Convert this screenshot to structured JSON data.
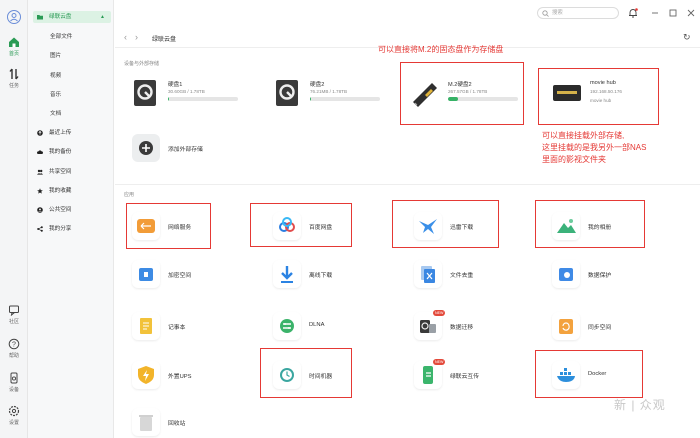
{
  "rail": {
    "items": [
      {
        "label": "首页",
        "icon": "home-icon"
      },
      {
        "label": "任务",
        "icon": "transfer-icon"
      },
      {
        "label": "社区",
        "icon": "chat-icon"
      },
      {
        "label": "帮助",
        "icon": "help-icon"
      },
      {
        "label": "设备",
        "icon": "device-icon"
      },
      {
        "label": "设置",
        "icon": "gear-icon"
      }
    ]
  },
  "sidebar": {
    "top": "绿联云盘",
    "items": [
      "全部文件",
      "图片",
      "视频",
      "音乐",
      "文档"
    ],
    "groups": [
      "最近上传",
      "我的备份",
      "共享空间",
      "我的收藏",
      "公共空间",
      "我的分享"
    ]
  },
  "header": {
    "search_placeholder": "搜索",
    "breadcrumb": "绿联云盘"
  },
  "storage": {
    "section_label": "设备与外部存储",
    "disks": [
      {
        "name": "硬盘1",
        "size": "30.60GB / 1.78TB",
        "percent": 2
      },
      {
        "name": "硬盘2",
        "size": "76.21MB / 1.78TB",
        "percent": 1
      },
      {
        "name": "M.2硬盘2",
        "size": "267.57GB / 1.78TB",
        "percent": 14
      },
      {
        "name": "movie hub",
        "size": "192.168.50.176",
        "sub": "movie hub"
      }
    ],
    "add_label": "添加外部存储"
  },
  "apps": {
    "section_label": "应用",
    "items": [
      {
        "name": "网络服务"
      },
      {
        "name": "百度网盘"
      },
      {
        "name": "迅雷下载"
      },
      {
        "name": "我的相册"
      },
      {
        "name": "加密空间"
      },
      {
        "name": "离线下载"
      },
      {
        "name": "文件去重"
      },
      {
        "name": "数据保护"
      },
      {
        "name": "记事本"
      },
      {
        "name": "DLNA"
      },
      {
        "name": "数据迁移",
        "badge": "NEW"
      },
      {
        "name": "同步空间"
      },
      {
        "name": "外置UPS"
      },
      {
        "name": "时间机器"
      },
      {
        "name": "绿联云互传",
        "badge": "NEW"
      },
      {
        "name": "Docker"
      },
      {
        "name": "回收站"
      }
    ]
  },
  "annotations": {
    "m2_note": "可以直接将M.2的固态盘作为存储盘",
    "nas_note_1": "可以直接挂载外部存储,",
    "nas_note_2": "这里挂载的是我另外一部NAS",
    "nas_note_3": "里面的影视文件夹"
  },
  "watermark": "新 | 众观",
  "colors": {
    "accent": "#2a9b55",
    "highlight": "#e53935"
  }
}
